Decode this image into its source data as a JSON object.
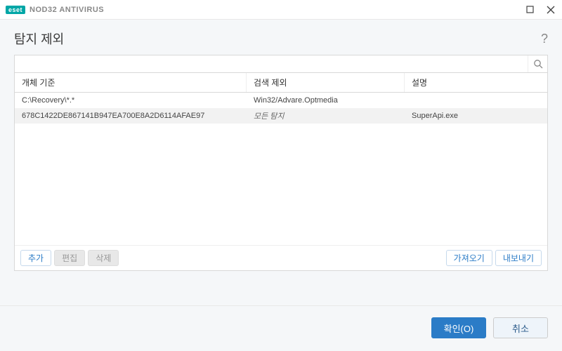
{
  "titlebar": {
    "brand_badge": "eset",
    "product_name": "NOD32 ANTIVIRUS"
  },
  "header": {
    "title": "탐지 제외"
  },
  "search": {
    "placeholder": ""
  },
  "table": {
    "columns": {
      "object": "개체 기준",
      "exclusion": "검색 제외",
      "description": "설명"
    },
    "rows": [
      {
        "object": "C:\\Recovery\\*.*",
        "exclusion": "Win32/Advare.Optmedia",
        "exclusion_italic": false,
        "description": ""
      },
      {
        "object": "678C1422DE867141B947EA700E8A2D6114AFAE97",
        "exclusion": "모든 탐지",
        "exclusion_italic": true,
        "description": "SuperApi.exe"
      }
    ]
  },
  "buttons": {
    "add": "추가",
    "edit": "편집",
    "delete": "삭제",
    "import": "가져오기",
    "export": "내보내기",
    "ok": "확인(O)",
    "cancel": "취소"
  }
}
